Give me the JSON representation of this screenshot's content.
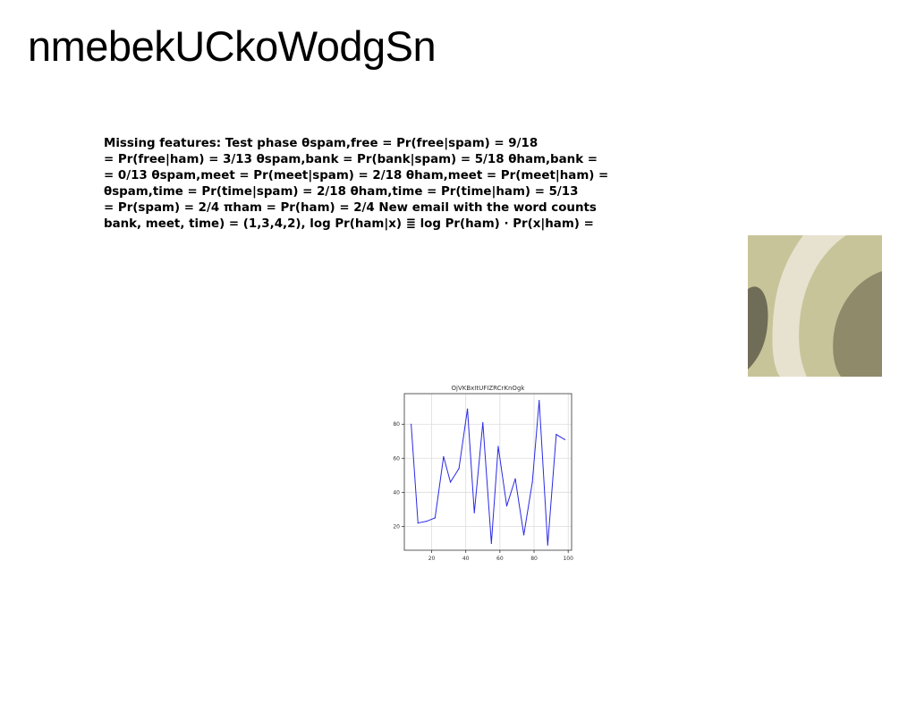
{
  "page": {
    "title": "nmebekUCkoWodgSn"
  },
  "text_block": {
    "lines": [
      "Missing features: Test phase θspam,free = Pr(free|spam) = 9/18",
      "= Pr(free|ham) = 3/13 θspam,bank = Pr(bank|spam) = 5/18 θham,bank =",
      "= 0/13 θspam,meet = Pr(meet|spam) = 2/18 θham,meet = Pr(meet|ham) =",
      "θspam,time = Pr(time|spam) = 2/18 θham,time = Pr(time|ham) = 5/13",
      "= Pr(spam) = 2/4 πham = Pr(ham) = 2/4 New email with the word counts",
      "bank, meet, time) = (1,3,4,2), log Pr(ham|x) ≣ log Pr(ham) · Pr(x|ham) ="
    ]
  },
  "image": {
    "icon": "abstract-curves-image",
    "colors": {
      "light": "#e6e2cf",
      "mid": "#c8c49a",
      "dark": "#8f8b6a",
      "shadow": "#6f6d57"
    }
  },
  "chart_data": {
    "type": "line",
    "title": "OjVKBxItUFIZRCrKnOgk",
    "xlabel": "",
    "ylabel": "",
    "x": [
      8,
      12,
      17,
      22,
      27,
      31,
      36,
      41,
      45,
      50,
      55,
      59,
      64,
      69,
      74,
      79,
      83,
      88,
      93,
      98
    ],
    "series": [
      {
        "values": [
          80,
          22,
          23,
          25,
          61,
          46,
          54,
          89,
          28,
          81,
          10,
          67,
          32,
          48,
          15,
          46,
          94,
          9,
          74,
          71
        ]
      }
    ],
    "xlim": [
      4,
      102
    ],
    "ylim": [
      6,
      98
    ],
    "xticks": [
      20,
      40,
      60,
      80,
      100
    ],
    "yticks": [
      20,
      40,
      60,
      80
    ],
    "grid": true,
    "line_color": "#2a2ae6"
  }
}
